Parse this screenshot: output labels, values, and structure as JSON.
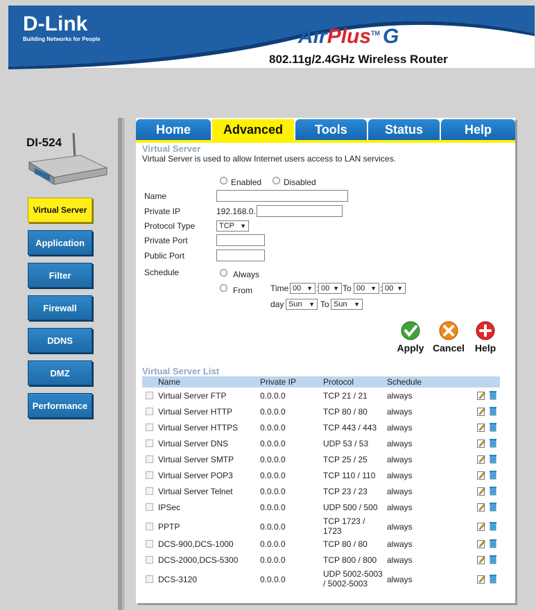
{
  "brand": {
    "logo_text": "D-Link",
    "tagline": "Building Networks for People",
    "product_air": "Air",
    "product_plus": "Plus",
    "product_tm": "TM",
    "product_g": "G",
    "model_line": "802.11g/2.4GHz Wireless Router",
    "device_name": "DI-524"
  },
  "colors": {
    "brand_blue": "#1f6aa6",
    "active_yellow": "#fff200",
    "list_header_bg": "#bcd6ef",
    "section_title": "#8fa7bf"
  },
  "tabs": [
    {
      "label": "Home",
      "active": false
    },
    {
      "label": "Advanced",
      "active": true
    },
    {
      "label": "Tools",
      "active": false
    },
    {
      "label": "Status",
      "active": false
    },
    {
      "label": "Help",
      "active": false
    }
  ],
  "sidebar": [
    {
      "label": "Virtual Server",
      "active": true
    },
    {
      "label": "Application",
      "active": false
    },
    {
      "label": "Filter",
      "active": false
    },
    {
      "label": "Firewall",
      "active": false
    },
    {
      "label": "DDNS",
      "active": false
    },
    {
      "label": "DMZ",
      "active": false
    },
    {
      "label": "Performance",
      "active": false
    }
  ],
  "section": {
    "title": "Virtual Server",
    "description": "Virtual Server is used to allow Internet users access to LAN services."
  },
  "form": {
    "enabled_label": "Enabled",
    "disabled_label": "Disabled",
    "name_label": "Name",
    "name_value": "",
    "private_ip_label": "Private IP",
    "private_ip_prefix": "192.168.0.",
    "private_ip_value": "",
    "protocol_label": "Protocol Type",
    "protocol_value": "TCP",
    "private_port_label": "Private Port",
    "private_port_value": "",
    "public_port_label": "Public Port",
    "public_port_value": "",
    "schedule_label": "Schedule",
    "always_label": "Always",
    "from_label": "From",
    "time_label": "Time",
    "time_sep": ":",
    "to_label": "To",
    "day_label": "day",
    "time_from_hour": "00",
    "time_from_min": "00",
    "time_to_hour": "00",
    "time_to_min": "00",
    "day_from": "Sun",
    "day_to": "Sun",
    "dropdown_arrow": "▼"
  },
  "actions": {
    "apply": "Apply",
    "cancel": "Cancel",
    "help": "Help"
  },
  "list": {
    "title": "Virtual Server List",
    "columns": [
      "Name",
      "Private IP",
      "Protocol",
      "Schedule"
    ],
    "rows": [
      {
        "name": "Virtual Server FTP",
        "ip": "0.0.0.0",
        "protocol": "TCP 21 / 21",
        "protocol2": "",
        "schedule": "always"
      },
      {
        "name": "Virtual Server HTTP",
        "ip": "0.0.0.0",
        "protocol": "TCP 80 / 80",
        "protocol2": "",
        "schedule": "always"
      },
      {
        "name": "Virtual Server HTTPS",
        "ip": "0.0.0.0",
        "protocol": "TCP 443 / 443",
        "protocol2": "",
        "schedule": "always"
      },
      {
        "name": "Virtual Server DNS",
        "ip": "0.0.0.0",
        "protocol": "UDP 53 / 53",
        "protocol2": "",
        "schedule": "always"
      },
      {
        "name": "Virtual Server SMTP",
        "ip": "0.0.0.0",
        "protocol": "TCP 25 / 25",
        "protocol2": "",
        "schedule": "always"
      },
      {
        "name": "Virtual Server POP3",
        "ip": "0.0.0.0",
        "protocol": "TCP 110 / 110",
        "protocol2": "",
        "schedule": "always"
      },
      {
        "name": "Virtual Server Telnet",
        "ip": "0.0.0.0",
        "protocol": "TCP 23 / 23",
        "protocol2": "",
        "schedule": "always"
      },
      {
        "name": "IPSec",
        "ip": "0.0.0.0",
        "protocol": "UDP 500 / 500",
        "protocol2": "",
        "schedule": "always"
      },
      {
        "name": "PPTP",
        "ip": "0.0.0.0",
        "protocol": "TCP 1723 /",
        "protocol2": "1723",
        "schedule": "always"
      },
      {
        "name": "DCS-900,DCS-1000",
        "ip": "0.0.0.0",
        "protocol": "TCP 80 / 80",
        "protocol2": "",
        "schedule": "always"
      },
      {
        "name": "DCS-2000,DCS-5300",
        "ip": "0.0.0.0",
        "protocol": "TCP 800 / 800",
        "protocol2": "",
        "schedule": "always"
      },
      {
        "name": "DCS-3120",
        "ip": "0.0.0.0",
        "protocol": "UDP 5002-5003",
        "protocol2": "/ 5002-5003",
        "schedule": "always"
      }
    ]
  }
}
